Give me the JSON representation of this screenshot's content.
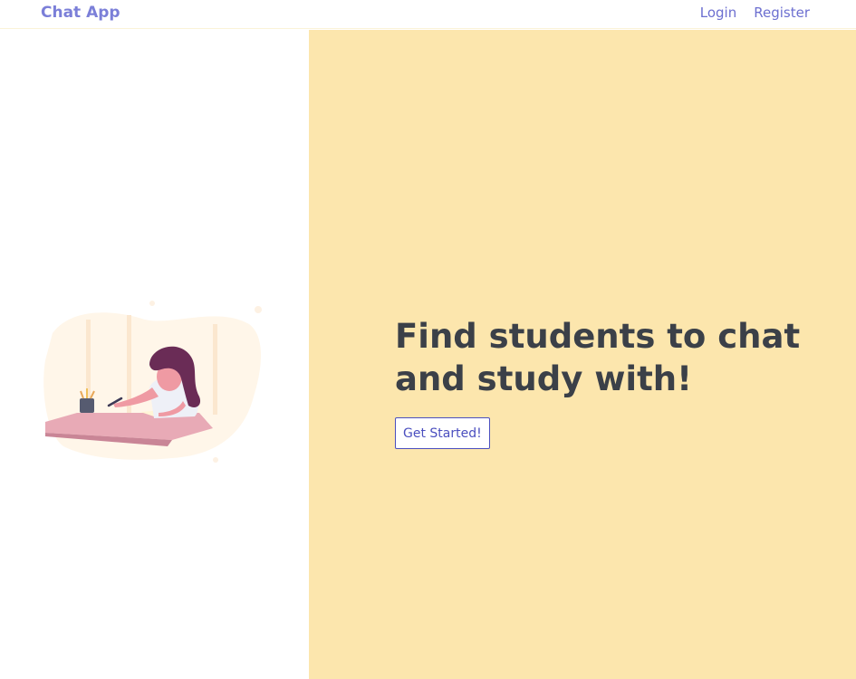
{
  "navbar": {
    "brand": "Chat App",
    "links": [
      {
        "label": "Login"
      },
      {
        "label": "Register"
      }
    ]
  },
  "hero": {
    "headline": "Find students to chat and study with!",
    "cta_label": "Get Started!"
  },
  "colors": {
    "brand": "#7b7fd8",
    "link": "#6c6fd0",
    "hero_background": "#fce6ad",
    "headline": "#3b4048",
    "button": "#4b4fbf"
  },
  "illustration": {
    "icon": "student-studying-illustration"
  }
}
